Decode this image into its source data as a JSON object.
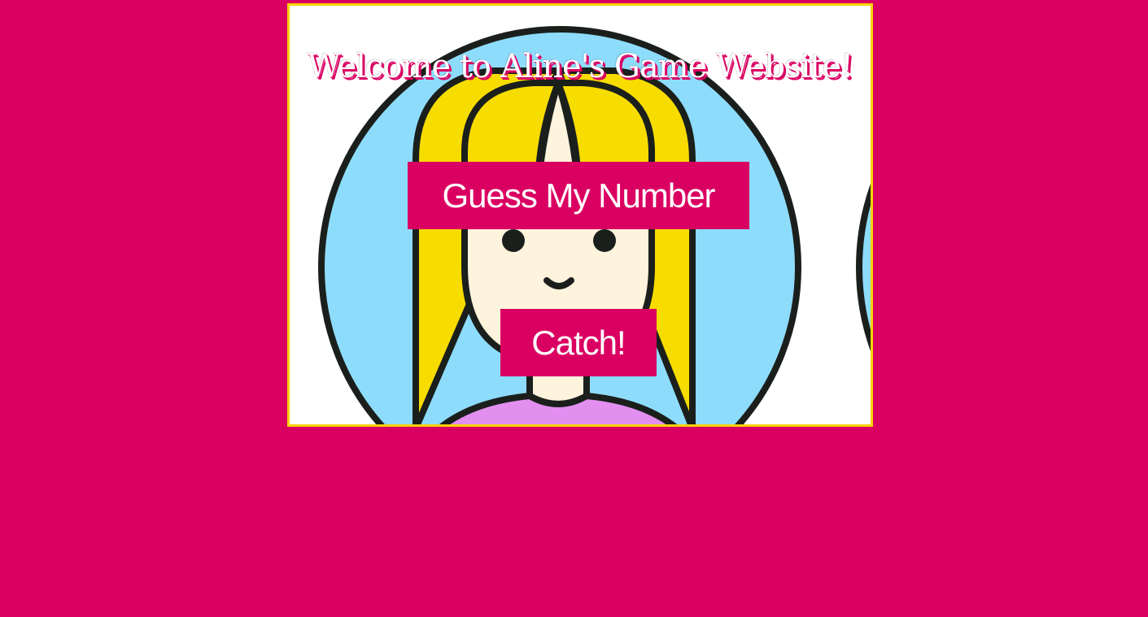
{
  "page": {
    "title": "Welcome to Aline's Game Website!"
  },
  "games": {
    "guess_label": "Guess My Number",
    "catch_label": "Catch!"
  },
  "illustration": {
    "subject": "girl-avatar-illustration"
  },
  "colors": {
    "background": "#DA0062",
    "frame_border": "#F7D200",
    "button_bg": "#DA0062",
    "button_text": "#FFFFFF",
    "hair": "#F7DC00",
    "circle": "#8EDCFB",
    "skin": "#FEF3DC",
    "shirt": "#E28FF0",
    "outline": "#1B1F1C"
  }
}
